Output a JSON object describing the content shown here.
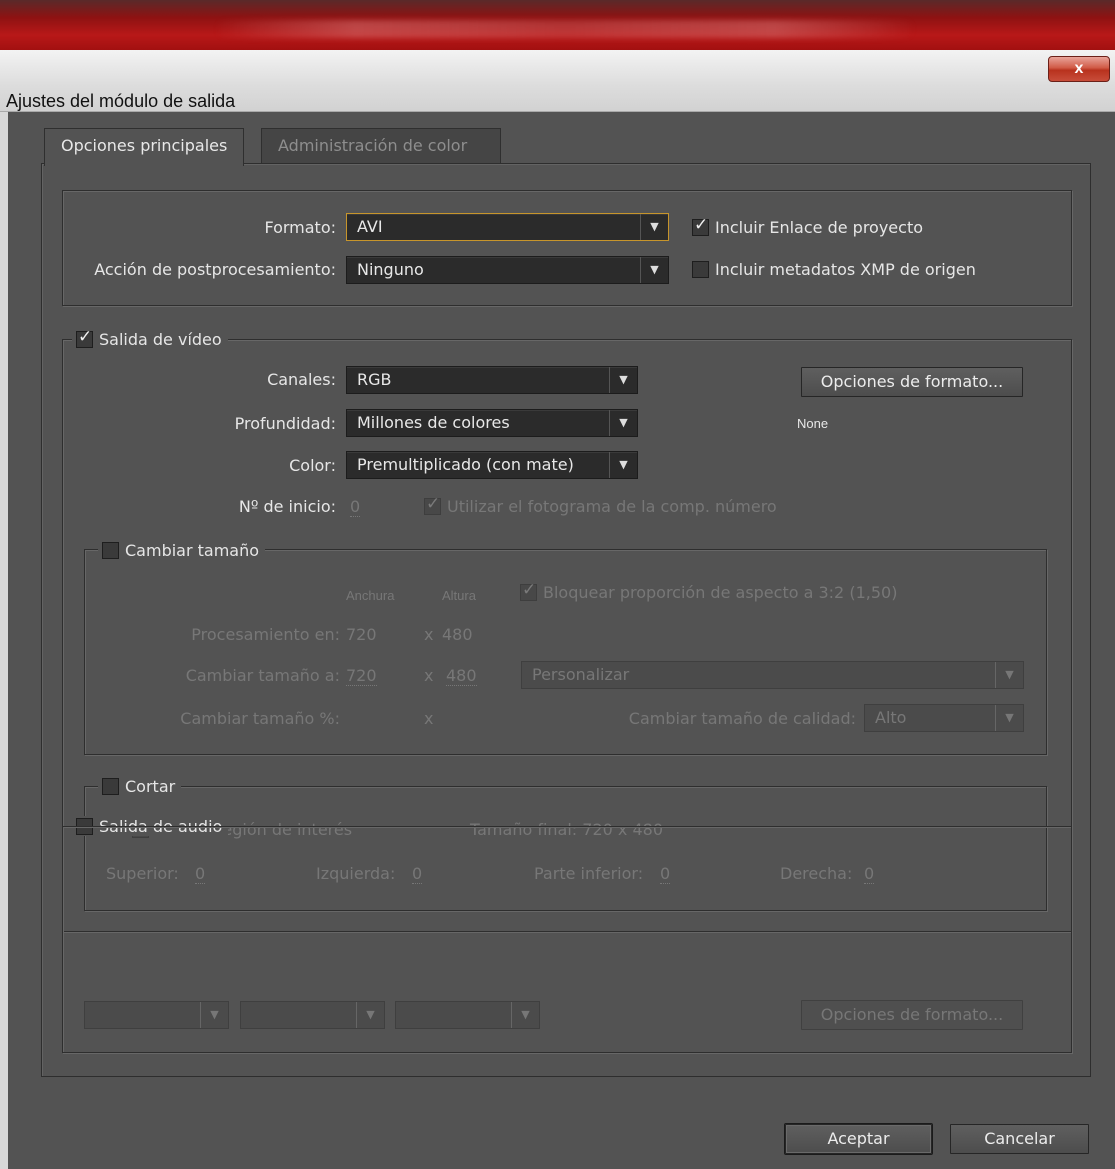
{
  "window": {
    "title": "Ajustes del módulo de salida",
    "close_label": "x"
  },
  "tabs": [
    {
      "label": "Opciones principales",
      "active": true
    },
    {
      "label": "Administración de color",
      "active": false
    }
  ],
  "format_section": {
    "format_label": "Formato:",
    "format_value": "AVI",
    "post_label": "Acción de postprocesamiento:",
    "post_value": "Ninguno",
    "include_project_link": {
      "label": "Incluir Enlace de proyecto",
      "checked": true
    },
    "include_xmp": {
      "label": "Incluir metadatos XMP de origen",
      "checked": false
    }
  },
  "video": {
    "legend": "Salida de vídeo",
    "checked": true,
    "channels_label": "Canales:",
    "channels_value": "RGB",
    "depth_label": "Profundidad:",
    "depth_value": "Millones de colores",
    "color_label": "Color:",
    "color_value": "Premultiplicado (con mate)",
    "start_label": "Nº de inicio:",
    "start_value": "0",
    "use_comp_frame": {
      "label": "Utilizar el fotograma de la comp. número",
      "checked": true
    },
    "format_options_button": "Opciones de formato...",
    "codec_text": "None"
  },
  "resize": {
    "legend": "Cambiar tamaño",
    "checked": false,
    "width_header": "Anchura",
    "height_header": "Altura",
    "lock_aspect": {
      "label": "Bloquear proporción de aspecto a 3:2 (1,50)",
      "checked": true
    },
    "render_at_label": "Procesamiento en:",
    "render_w": "720",
    "render_h": "480",
    "resize_to_label": "Cambiar tamaño a:",
    "resize_w": "720",
    "resize_h": "480",
    "preset_value": "Personalizar",
    "percent_label": "Cambiar tamaño %:",
    "x_sep": "x",
    "quality_label": "Cambiar tamaño de calidad:",
    "quality_value": "Alto"
  },
  "crop": {
    "legend": "Cortar",
    "checked": false,
    "use_roi": {
      "label": "Utilizar región de interés",
      "checked": false
    },
    "final_size": "Tamaño final: 720 x 480",
    "top_label": "Superior:",
    "top_value": "0",
    "left_label": "Izquierda:",
    "left_value": "0",
    "bottom_label": "Parte inferior:",
    "bottom_value": "0",
    "right_label": "Derecha:",
    "right_value": "0"
  },
  "audio": {
    "legend": "Salida de audio",
    "checked": false,
    "format_options_button": "Opciones de formato..."
  },
  "footer": {
    "ok": "Aceptar",
    "cancel": "Cancelar"
  },
  "colors": {
    "accent_focus": "#c7952b",
    "panel": "#535353",
    "titlebar_red": "#b81818"
  }
}
